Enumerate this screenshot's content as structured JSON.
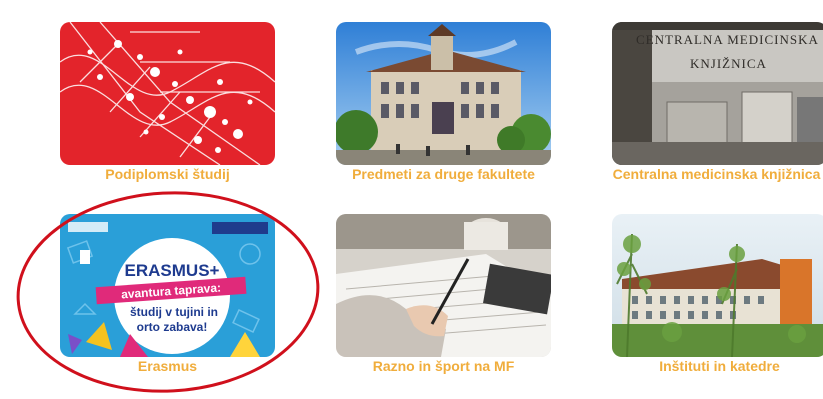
{
  "tiles": [
    {
      "label": "Podiplomski študij",
      "icon": "dna-helix-image"
    },
    {
      "label": "Predmeti za druge fakultete",
      "icon": "university-building-image"
    },
    {
      "label": "Centralna medicinska knjižnica",
      "icon": "library-entrance-image"
    },
    {
      "label": "Erasmus",
      "icon": "erasmus-poster-image"
    },
    {
      "label": "Razno in šport na MF",
      "icon": "writing-hand-image"
    },
    {
      "label": "Inštituti in katedre",
      "icon": "institute-building-image"
    }
  ],
  "erasmus_poster": {
    "title": "ERASMUS+",
    "line1": "avantura taprava:",
    "line2": "študij v tujini in",
    "line3": "orto zabava!"
  },
  "library_sign": {
    "line1": "CENTRALNA MEDICINSKA",
    "line2": "KNJIŽNICA"
  },
  "colors": {
    "caption": "#f0ad3c",
    "highlight_circle": "#d0101c",
    "erasmus_pink": "#e02a7a",
    "tile_red": "#e3242b"
  }
}
